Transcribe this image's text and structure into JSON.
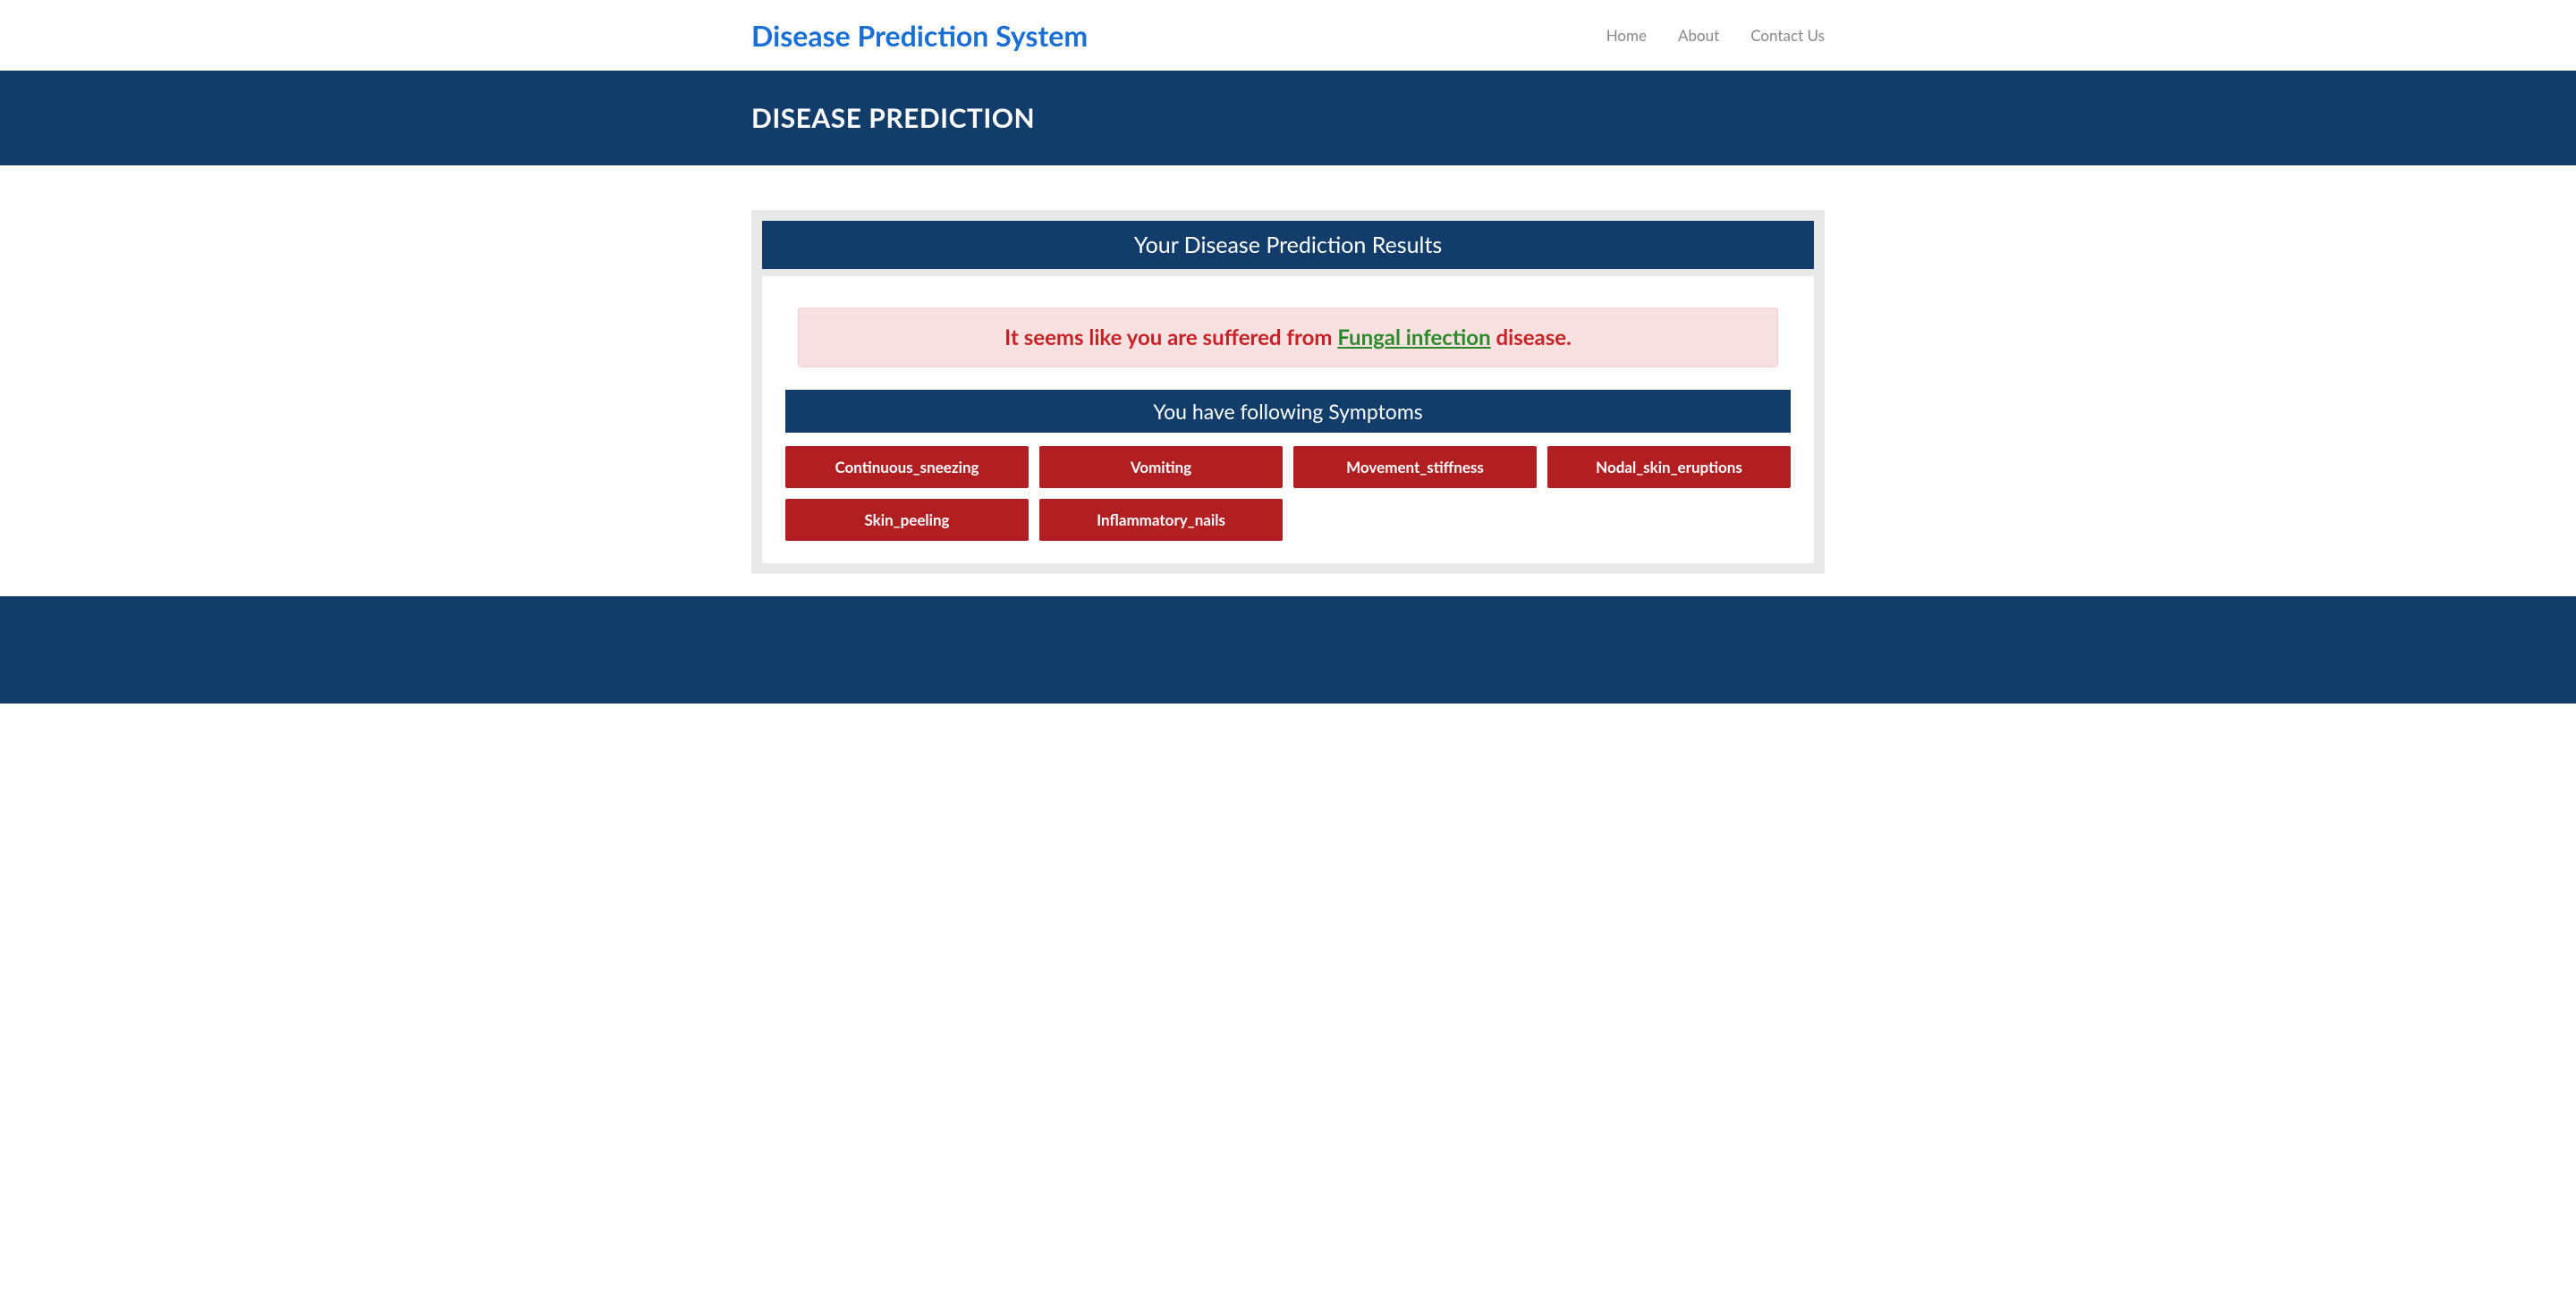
{
  "header": {
    "brand": "Disease Prediction System",
    "nav": [
      {
        "label": "Home"
      },
      {
        "label": "About"
      },
      {
        "label": "Contact Us"
      }
    ]
  },
  "page": {
    "title": "DISEASE PREDICTION"
  },
  "results": {
    "heading": "Your Disease Prediction Results",
    "message_prefix": "It seems like you are suffered from ",
    "disease_name": "Fungal infection",
    "message_suffix": " disease.",
    "symptoms_heading": "You have following Symptoms",
    "symptoms": [
      "Continuous_sneezing",
      "Vomiting",
      "Movement_stiffness",
      "Nodal_skin_eruptions",
      "Skin_peeling",
      "Inflammatory_nails"
    ]
  }
}
